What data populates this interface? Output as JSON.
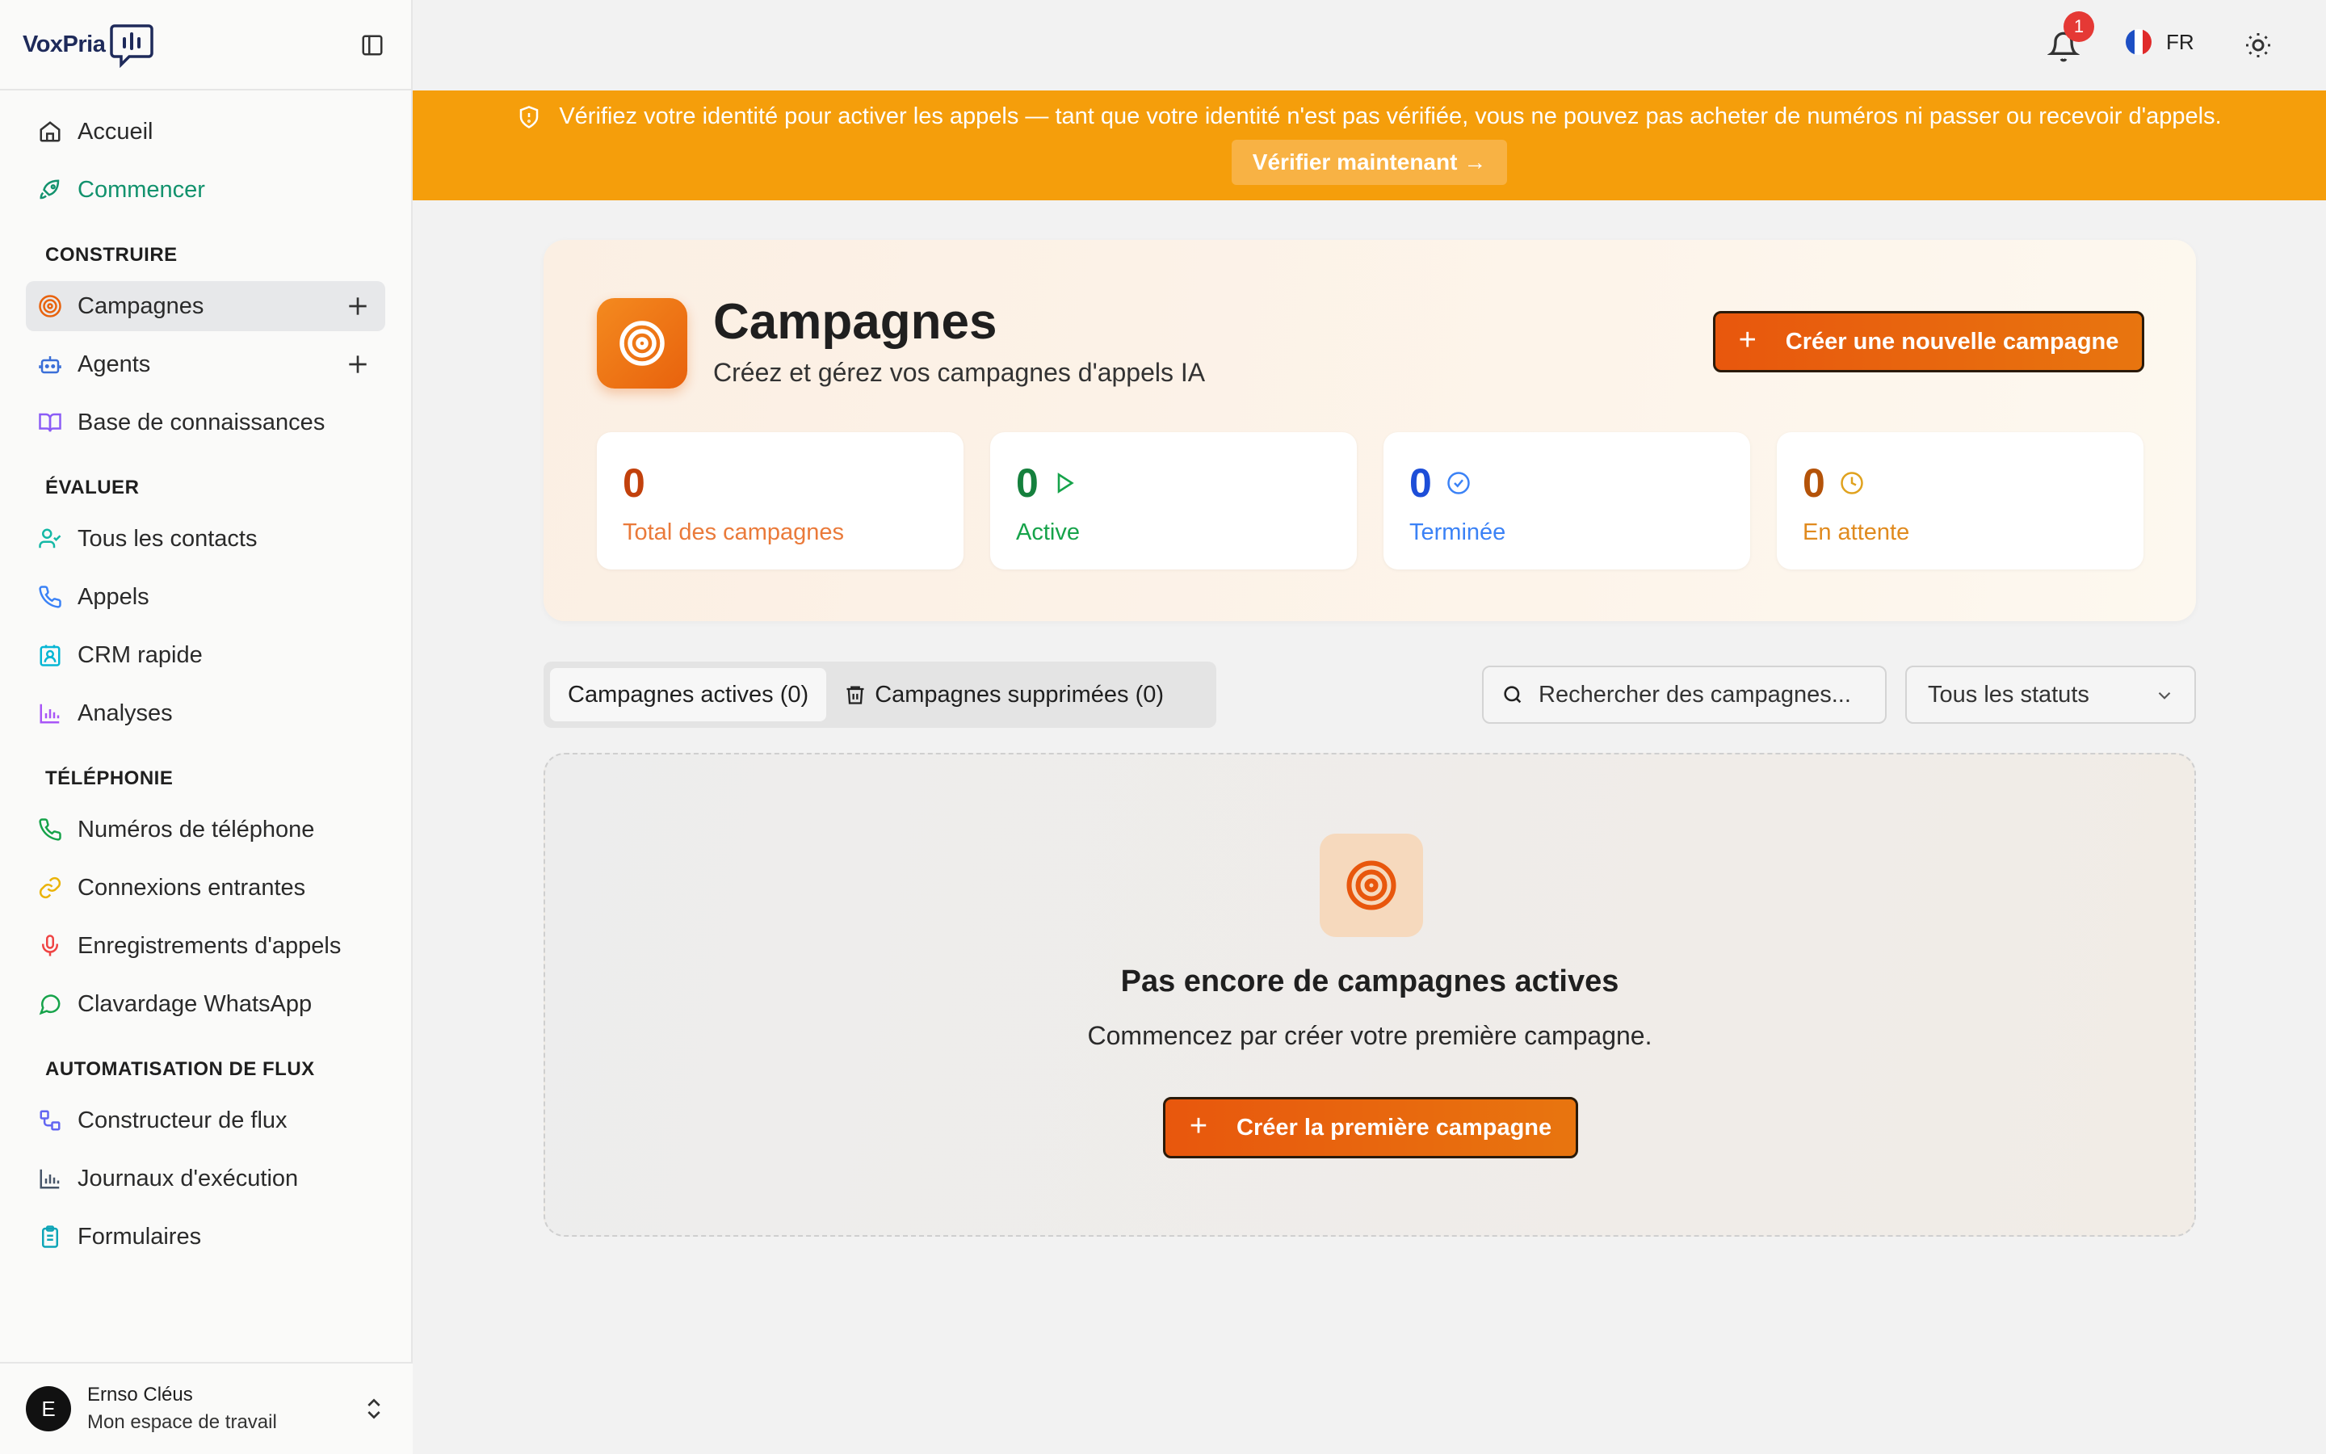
{
  "brand": {
    "logo_text": "VoxPria"
  },
  "sidebar": {
    "top_items": [
      {
        "label": "Accueil",
        "icon": "home-icon"
      },
      {
        "label": "Commencer",
        "icon": "rocket-icon"
      }
    ],
    "sections": [
      {
        "title": "CONSTRUIRE",
        "items": [
          {
            "label": "Campagnes",
            "icon": "target-icon",
            "active": true
          },
          {
            "label": "Agents",
            "icon": "bot-icon"
          },
          {
            "label": "Base de connaissances",
            "icon": "book-icon"
          }
        ]
      },
      {
        "title": "ÉVALUER",
        "items": [
          {
            "label": "Tous les contacts",
            "icon": "user-check-icon"
          },
          {
            "label": "Appels",
            "icon": "phone-icon"
          },
          {
            "label": "CRM rapide",
            "icon": "contact-card-icon"
          },
          {
            "label": "Analyses",
            "icon": "bar-chart-icon"
          }
        ]
      },
      {
        "title": "TÉLÉPHONIE",
        "items": [
          {
            "label": "Numéros de téléphone",
            "icon": "phone-icon"
          },
          {
            "label": "Connexions entrantes",
            "icon": "link-icon"
          },
          {
            "label": "Enregistrements d'appels",
            "icon": "mic-icon"
          },
          {
            "label": "Clavardage WhatsApp",
            "icon": "message-circle-icon"
          }
        ]
      },
      {
        "title": "AUTOMATISATION DE FLUX",
        "items": [
          {
            "label": "Constructeur de flux",
            "icon": "workflow-icon"
          },
          {
            "label": "Journaux d'exécution",
            "icon": "bar-chart-icon"
          },
          {
            "label": "Formulaires",
            "icon": "clipboard-icon"
          }
        ]
      }
    ],
    "user": {
      "initial": "E",
      "name": "Ernso Cléus",
      "workspace": "Mon espace de travail"
    }
  },
  "topbar": {
    "notification_count": "1",
    "language": "FR"
  },
  "banner": {
    "text": "Vérifiez votre identité pour activer les appels — tant que votre identité n'est pas vérifiée, vous ne pouvez pas acheter de numéros ni passer ou recevoir d'appels.",
    "button": "Vérifier maintenant →"
  },
  "header": {
    "title": "Campagnes",
    "subtitle": "Créez et gérez vos campagnes d'appels IA",
    "create_button": "Créer une nouvelle campagne"
  },
  "stats": [
    {
      "value": "0",
      "label": "Total des campagnes",
      "color": "#c2410c",
      "label_color": "#ea7a3a"
    },
    {
      "value": "0",
      "label": "Active",
      "color": "#15803d",
      "label_color": "#16a34a"
    },
    {
      "value": "0",
      "label": "Terminée",
      "color": "#1d4ed8",
      "label_color": "#3b82f6"
    },
    {
      "value": "0",
      "label": "En attente",
      "color": "#b45309",
      "label_color": "#e08a1e"
    }
  ],
  "tabs": {
    "active": "Campagnes actives (0)",
    "deleted": "Campagnes supprimées (0)"
  },
  "search": {
    "placeholder": "Rechercher des campagnes..."
  },
  "status_filter": {
    "selected": "Tous les statuts"
  },
  "empty": {
    "title": "Pas encore de campagnes actives",
    "subtitle": "Commencez par créer votre première campagne.",
    "button": "Créer la première campagne"
  },
  "colors": {
    "accent": "#e8620d",
    "banner": "#f59e0b",
    "active_green": "#12926d"
  }
}
